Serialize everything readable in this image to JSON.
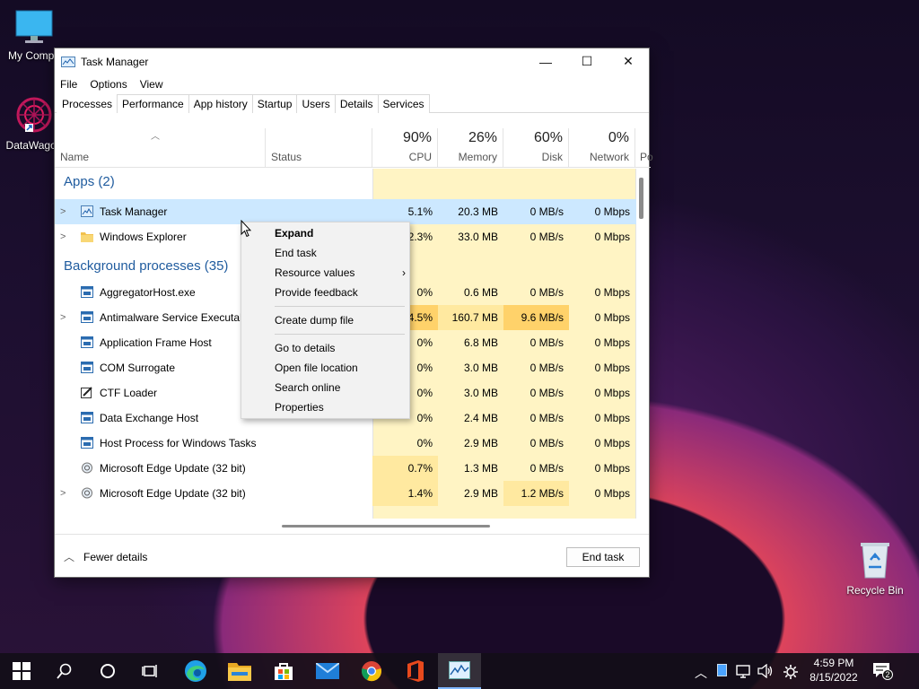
{
  "desktop": {
    "icons": [
      {
        "label": "My Compu"
      },
      {
        "label": "DataWagon"
      },
      {
        "label": "Recycle Bin"
      }
    ]
  },
  "window": {
    "title": "Task Manager",
    "controls": {
      "minimize": "—",
      "maximize": "☐",
      "close": "✕"
    }
  },
  "menu": [
    "File",
    "Options",
    "View"
  ],
  "tabs": [
    "Processes",
    "Performance",
    "App history",
    "Startup",
    "Users",
    "Details",
    "Services"
  ],
  "columns": {
    "name": "Name",
    "status": "Status",
    "cpu": {
      "pct": "90%",
      "label": "CPU"
    },
    "memory": {
      "pct": "26%",
      "label": "Memory"
    },
    "disk": {
      "pct": "60%",
      "label": "Disk"
    },
    "network": {
      "pct": "0%",
      "label": "Network"
    },
    "power": "Po"
  },
  "groups": {
    "apps": "Apps (2)",
    "background": "Background processes (35)"
  },
  "rows": [
    {
      "name": "Task Manager",
      "cpu": "5.1%",
      "memory": "20.3 MB",
      "disk": "0 MB/s",
      "network": "0 Mbps"
    },
    {
      "name": "Windows Explorer",
      "cpu": "2.3%",
      "memory": "33.0 MB",
      "disk": "0 MB/s",
      "network": "0 Mbps"
    },
    {
      "name": "AggregatorHost.exe",
      "cpu": "0%",
      "memory": "0.6 MB",
      "disk": "0 MB/s",
      "network": "0 Mbps"
    },
    {
      "name": "Antimalware Service Executable",
      "cpu": "4.5%",
      "memory": "160.7 MB",
      "disk": "9.6 MB/s",
      "network": "0 Mbps"
    },
    {
      "name": "Application Frame Host",
      "cpu": "0%",
      "memory": "6.8 MB",
      "disk": "0 MB/s",
      "network": "0 Mbps"
    },
    {
      "name": "COM Surrogate",
      "cpu": "0%",
      "memory": "3.0 MB",
      "disk": "0 MB/s",
      "network": "0 Mbps"
    },
    {
      "name": "CTF Loader",
      "cpu": "0%",
      "memory": "3.0 MB",
      "disk": "0 MB/s",
      "network": "0 Mbps"
    },
    {
      "name": "Data Exchange Host",
      "cpu": "0%",
      "memory": "2.4 MB",
      "disk": "0 MB/s",
      "network": "0 Mbps"
    },
    {
      "name": "Host Process for Windows Tasks",
      "cpu": "0%",
      "memory": "2.9 MB",
      "disk": "0 MB/s",
      "network": "0 Mbps"
    },
    {
      "name": "Microsoft Edge Update (32 bit)",
      "cpu": "0.7%",
      "memory": "1.3 MB",
      "disk": "0 MB/s",
      "network": "0 Mbps"
    },
    {
      "name": "Microsoft Edge Update (32 bit)",
      "cpu": "1.4%",
      "memory": "2.9 MB",
      "disk": "1.2 MB/s",
      "network": "0 Mbps"
    }
  ],
  "context_menu": [
    "Expand",
    "End task",
    "Resource values",
    "Provide feedback",
    "Create dump file",
    "Go to details",
    "Open file location",
    "Search online",
    "Properties"
  ],
  "footer": {
    "fewer": "Fewer details",
    "end_task": "End task"
  },
  "taskbar": {
    "time": "4:59 PM",
    "date": "8/15/2022",
    "notifications": "2"
  },
  "colors": {
    "selected": "#cce8ff",
    "heat_low": "#fff4c4",
    "heat_mid": "#ffe9a0",
    "heat_high": "#ffd26a",
    "group_text": "#1f5b9e"
  }
}
